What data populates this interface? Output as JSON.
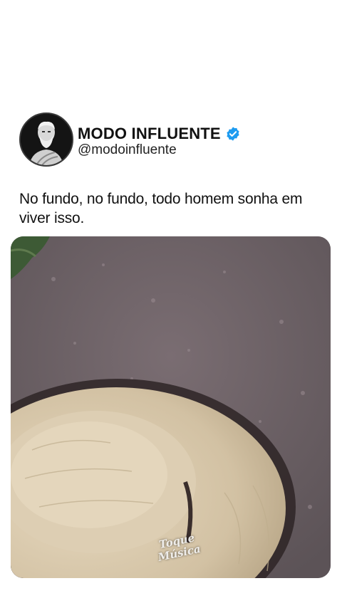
{
  "profile": {
    "name": "MODO INFLUENTE",
    "handle": "@modoinfluente",
    "verified": true,
    "verified_color": "#1d9bf0",
    "avatar_icon": "philosopher-bust-icon"
  },
  "post": {
    "caption": "No fundo, no fundo, todo homem sonha em viver isso."
  },
  "media": {
    "description_icon": "straw-hat-video-frame",
    "watermark_line1": "Toque",
    "watermark_line2": "Música"
  },
  "colors": {
    "background": "#ffffff",
    "text": "#111111",
    "media_ground": "#6f6468",
    "hat": "#d9c9ad"
  }
}
